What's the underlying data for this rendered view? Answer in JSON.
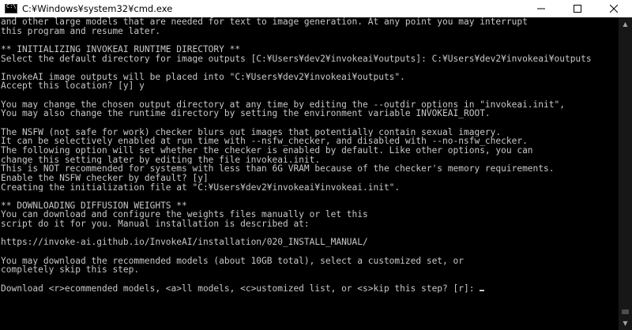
{
  "window": {
    "title": "C:¥Windows¥system32¥cmd.exe",
    "minimize_glyph": "—",
    "maximize_glyph": "☐",
    "close_glyph": "✕"
  },
  "console": {
    "lines": [
      "and other large models that are needed for text to image generation. At any point you may interrupt",
      "this program and resume later.",
      "",
      "** INITIALIZING INVOKEAI RUNTIME DIRECTORY **",
      "Select the default directory for image outputs [C:¥Users¥dev2¥invokeai¥outputs]: C:¥Users¥dev2¥invokeai¥outputs",
      "",
      "InvokeAI image outputs will be placed into \"C:¥Users¥dev2¥invokeai¥outputs\".",
      "Accept this location? [y] y",
      "",
      "You may change the chosen output directory at any time by editing the --outdir options in \"invokeai.init\",",
      "You may also change the runtime directory by setting the environment variable INVOKEAI_ROOT.",
      "",
      "The NSFW (not safe for work) checker blurs out images that potentially contain sexual imagery.",
      "It can be selectively enabled at run time with --nsfw_checker, and disabled with --no-nsfw_checker.",
      "The following option will set whether the checker is enabled by default. Like other options, you can",
      "change this setting later by editing the file invokeai.init.",
      "This is NOT recommended for systems with less than 6G VRAM because of the checker's memory requirements.",
      "Enable the NSFW checker by default? [y]",
      "Creating the initialization file at \"C:¥Users¥dev2¥invokeai¥invokeai.init\".",
      "",
      "** DOWNLOADING DIFFUSION WEIGHTS **",
      "You can download and configure the weights files manually or let this",
      "script do it for you. Manual installation is described at:",
      "",
      "https://invoke-ai.github.io/InvokeAI/installation/020_INSTALL_MANUAL/",
      "",
      "You may download the recommended models (about 10GB total), select a customized set, or",
      "completely skip this step.",
      "",
      "Download <r>ecommended models, <a>ll models, <c>ustomized list, or <s>kip this step? [r]: "
    ]
  }
}
